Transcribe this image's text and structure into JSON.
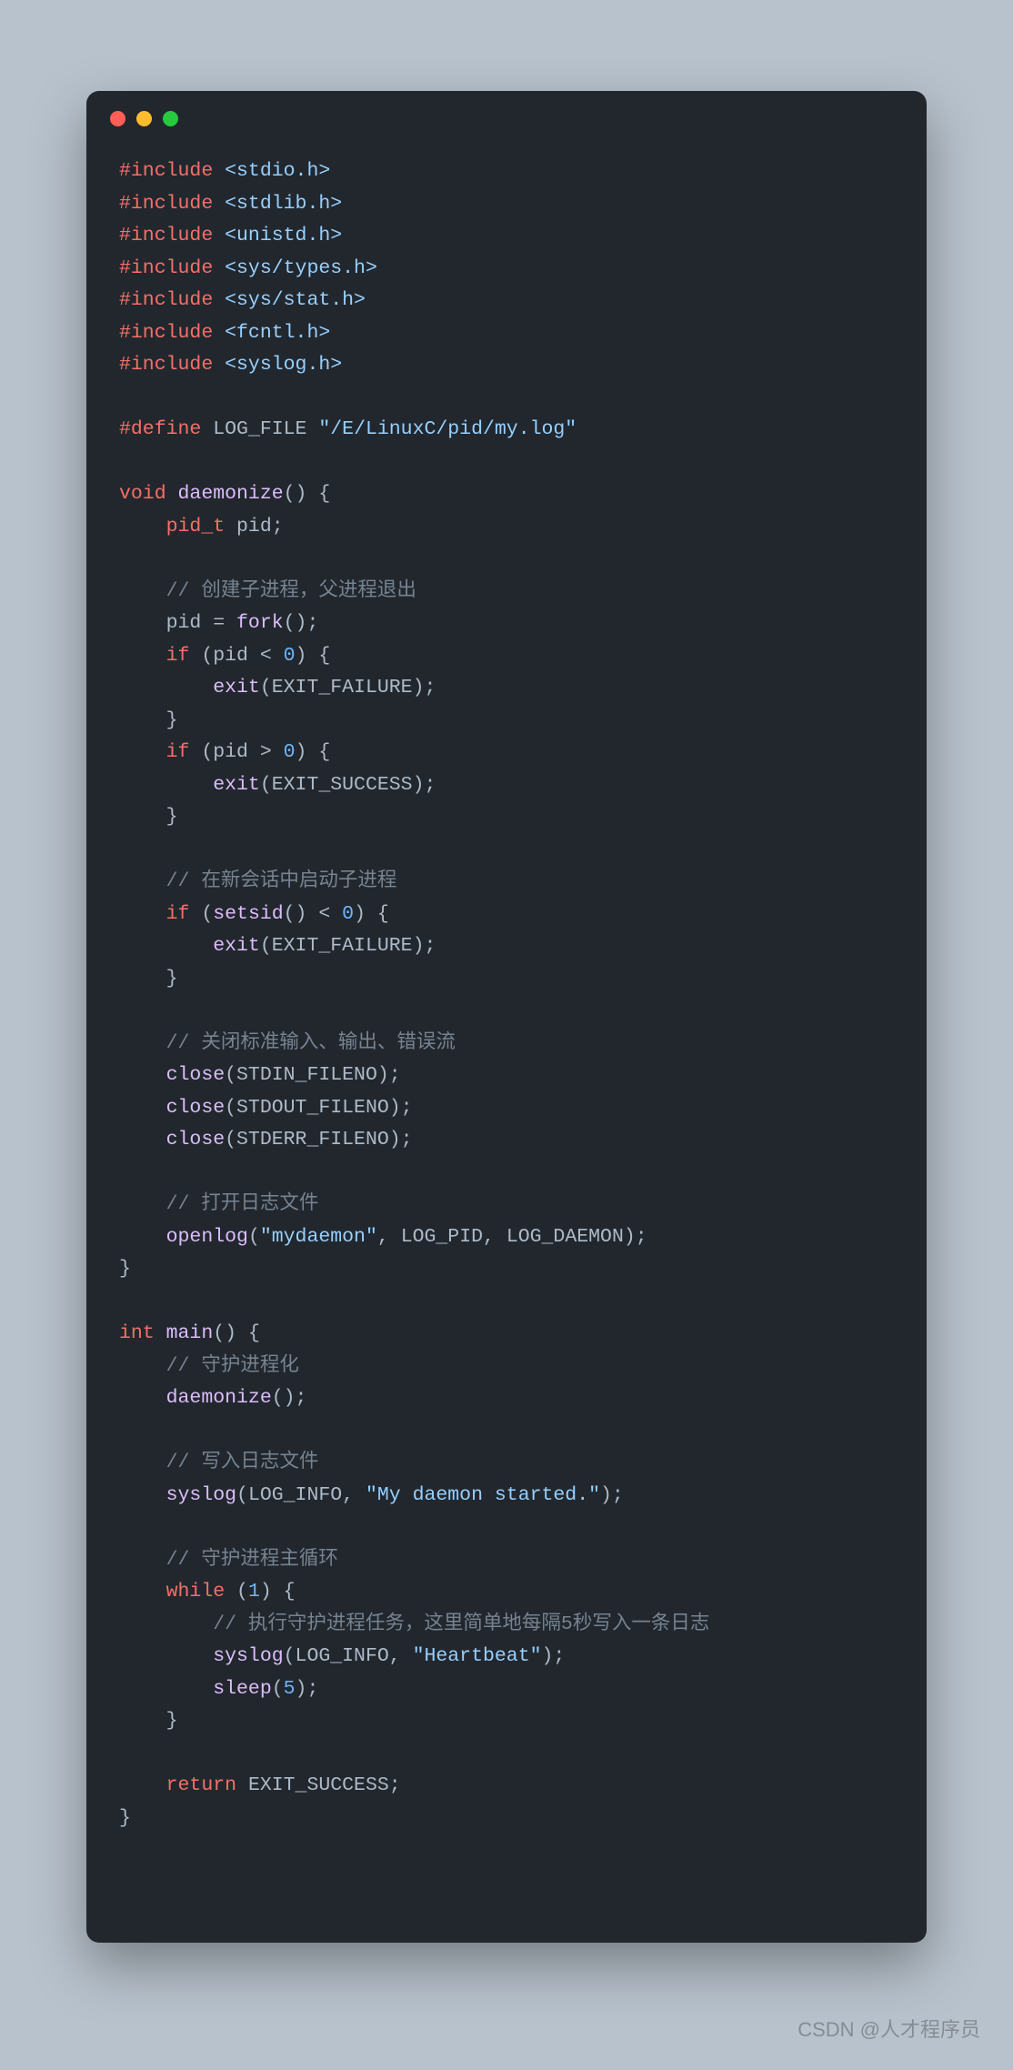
{
  "watermark": "CSDN @人才程序员",
  "code": {
    "includes": [
      "<stdio.h>",
      "<stdlib.h>",
      "<unistd.h>",
      "<sys/types.h>",
      "<sys/stat.h>",
      "<fcntl.h>",
      "<syslog.h>"
    ],
    "define_name": "LOG_FILE",
    "define_value": "\"/E/LinuxC/pid/my.log\"",
    "fn_daemonize": "daemonize",
    "fn_main": "main",
    "pid_decl_type": "pid_t",
    "pid_decl_name": "pid",
    "comment_fork": "// 创建子进程，父进程退出",
    "call_fork": "fork",
    "cmp_zero": "0",
    "exit_fn": "exit",
    "const_exit_failure": "EXIT_FAILURE",
    "const_exit_success": "EXIT_SUCCESS",
    "comment_setsid": "// 在新会话中启动子进程",
    "call_setsid": "setsid",
    "comment_close": "// 关闭标准输入、输出、错误流",
    "call_close": "close",
    "stdin": "STDIN_FILENO",
    "stdout": "STDOUT_FILENO",
    "stderr": "STDERR_FILENO",
    "comment_openlog": "// 打开日志文件",
    "call_openlog": "openlog",
    "openlog_arg1": "\"mydaemon\"",
    "openlog_arg2": "LOG_PID",
    "openlog_arg3": "LOG_DAEMON",
    "comment_main1": "// 守护进程化",
    "comment_main2": "// 写入日志文件",
    "call_syslog": "syslog",
    "syslog_info": "LOG_INFO",
    "syslog_msg1": "\"My daemon started.\"",
    "comment_main3": "// 守护进程主循环",
    "while_cond": "1",
    "comment_loop": "// 执行守护进程任务，这里简单地每隔5秒写入一条日志",
    "syslog_msg2": "\"Heartbeat\"",
    "call_sleep": "sleep",
    "sleep_arg": "5",
    "kw_include": "#include",
    "kw_define": "#define",
    "kw_void": "void",
    "kw_int": "int",
    "kw_if": "if",
    "kw_while": "while",
    "kw_return": "return"
  }
}
